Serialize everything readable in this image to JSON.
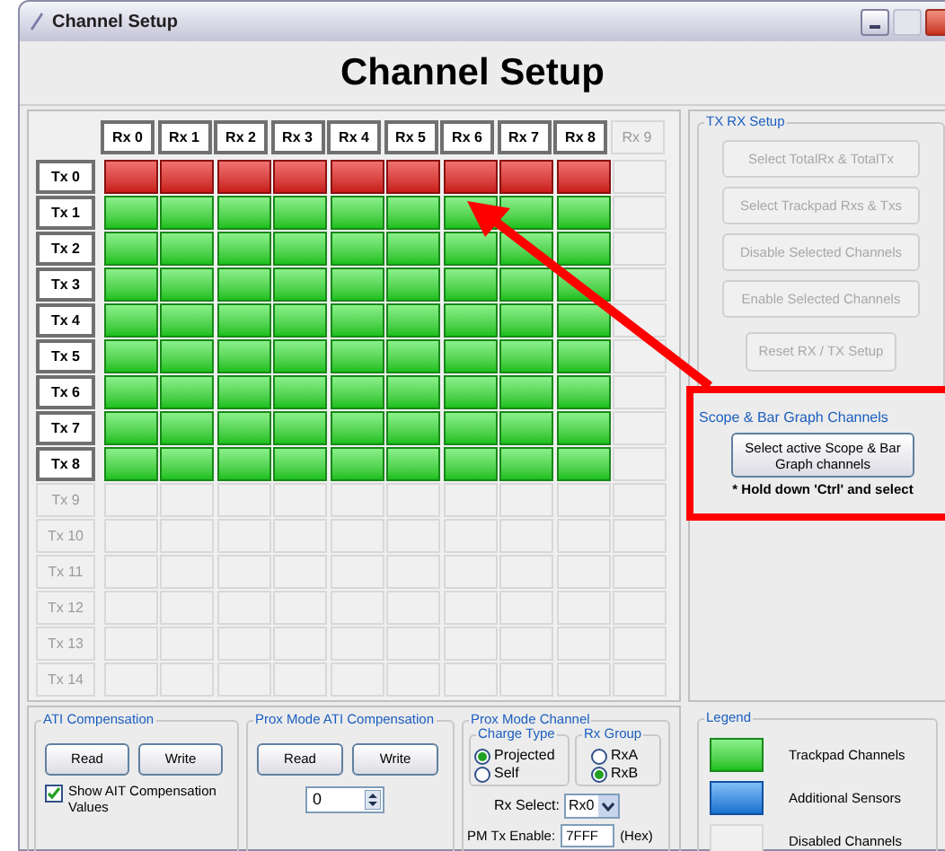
{
  "window": {
    "title": "Channel Setup"
  },
  "heading": "Channel Setup",
  "grid": {
    "columns": [
      {
        "label": "Rx 0",
        "enabled": true
      },
      {
        "label": "Rx 1",
        "enabled": true
      },
      {
        "label": "Rx 2",
        "enabled": true
      },
      {
        "label": "Rx 3",
        "enabled": true
      },
      {
        "label": "Rx 4",
        "enabled": true
      },
      {
        "label": "Rx 5",
        "enabled": true
      },
      {
        "label": "Rx 6",
        "enabled": true
      },
      {
        "label": "Rx 7",
        "enabled": true
      },
      {
        "label": "Rx 8",
        "enabled": true
      },
      {
        "label": "Rx 9",
        "enabled": false
      }
    ],
    "rows": [
      {
        "label": "Tx 0",
        "enabled": true,
        "cells": [
          {
            "kind": "selected"
          },
          {
            "kind": "selected"
          },
          {
            "kind": "selected"
          },
          {
            "kind": "selected"
          },
          {
            "kind": "selected"
          },
          {
            "kind": "selected"
          },
          {
            "kind": "selected"
          },
          {
            "kind": "selected"
          },
          {
            "kind": "selected"
          },
          {
            "kind": "disabled"
          }
        ]
      },
      {
        "label": "Tx 1",
        "enabled": true,
        "cells": [
          {
            "kind": "trackpad"
          },
          {
            "kind": "trackpad"
          },
          {
            "kind": "trackpad"
          },
          {
            "kind": "trackpad"
          },
          {
            "kind": "trackpad"
          },
          {
            "kind": "trackpad"
          },
          {
            "kind": "trackpad"
          },
          {
            "kind": "trackpad"
          },
          {
            "kind": "trackpad"
          },
          {
            "kind": "disabled"
          }
        ]
      },
      {
        "label": "Tx 2",
        "enabled": true,
        "cells": [
          {
            "kind": "trackpad"
          },
          {
            "kind": "trackpad"
          },
          {
            "kind": "trackpad"
          },
          {
            "kind": "trackpad"
          },
          {
            "kind": "trackpad"
          },
          {
            "kind": "trackpad"
          },
          {
            "kind": "trackpad"
          },
          {
            "kind": "trackpad"
          },
          {
            "kind": "trackpad"
          },
          {
            "kind": "disabled"
          }
        ]
      },
      {
        "label": "Tx 3",
        "enabled": true,
        "cells": [
          {
            "kind": "trackpad"
          },
          {
            "kind": "trackpad"
          },
          {
            "kind": "trackpad"
          },
          {
            "kind": "trackpad"
          },
          {
            "kind": "trackpad"
          },
          {
            "kind": "trackpad"
          },
          {
            "kind": "trackpad"
          },
          {
            "kind": "trackpad"
          },
          {
            "kind": "trackpad"
          },
          {
            "kind": "disabled"
          }
        ]
      },
      {
        "label": "Tx 4",
        "enabled": true,
        "cells": [
          {
            "kind": "trackpad"
          },
          {
            "kind": "trackpad"
          },
          {
            "kind": "trackpad"
          },
          {
            "kind": "trackpad"
          },
          {
            "kind": "trackpad"
          },
          {
            "kind": "trackpad"
          },
          {
            "kind": "trackpad"
          },
          {
            "kind": "trackpad"
          },
          {
            "kind": "trackpad"
          },
          {
            "kind": "disabled"
          }
        ]
      },
      {
        "label": "Tx 5",
        "enabled": true,
        "cells": [
          {
            "kind": "trackpad"
          },
          {
            "kind": "trackpad"
          },
          {
            "kind": "trackpad"
          },
          {
            "kind": "trackpad"
          },
          {
            "kind": "trackpad"
          },
          {
            "kind": "trackpad"
          },
          {
            "kind": "trackpad"
          },
          {
            "kind": "trackpad"
          },
          {
            "kind": "trackpad"
          },
          {
            "kind": "disabled"
          }
        ]
      },
      {
        "label": "Tx 6",
        "enabled": true,
        "cells": [
          {
            "kind": "trackpad"
          },
          {
            "kind": "trackpad"
          },
          {
            "kind": "trackpad"
          },
          {
            "kind": "trackpad"
          },
          {
            "kind": "trackpad"
          },
          {
            "kind": "trackpad"
          },
          {
            "kind": "trackpad"
          },
          {
            "kind": "trackpad"
          },
          {
            "kind": "trackpad"
          },
          {
            "kind": "disabled"
          }
        ]
      },
      {
        "label": "Tx 7",
        "enabled": true,
        "cells": [
          {
            "kind": "trackpad"
          },
          {
            "kind": "trackpad"
          },
          {
            "kind": "trackpad"
          },
          {
            "kind": "trackpad"
          },
          {
            "kind": "trackpad"
          },
          {
            "kind": "trackpad"
          },
          {
            "kind": "trackpad"
          },
          {
            "kind": "trackpad"
          },
          {
            "kind": "trackpad"
          },
          {
            "kind": "disabled"
          }
        ]
      },
      {
        "label": "Tx 8",
        "enabled": true,
        "cells": [
          {
            "kind": "trackpad"
          },
          {
            "kind": "trackpad"
          },
          {
            "kind": "trackpad"
          },
          {
            "kind": "trackpad"
          },
          {
            "kind": "trackpad"
          },
          {
            "kind": "trackpad"
          },
          {
            "kind": "trackpad"
          },
          {
            "kind": "trackpad"
          },
          {
            "kind": "trackpad"
          },
          {
            "kind": "disabled"
          }
        ]
      },
      {
        "label": "Tx 9",
        "enabled": false,
        "cells": [
          {
            "kind": "disabled"
          },
          {
            "kind": "disabled"
          },
          {
            "kind": "disabled"
          },
          {
            "kind": "disabled"
          },
          {
            "kind": "disabled"
          },
          {
            "kind": "disabled"
          },
          {
            "kind": "disabled"
          },
          {
            "kind": "disabled"
          },
          {
            "kind": "disabled"
          },
          {
            "kind": "disabled"
          }
        ]
      },
      {
        "label": "Tx 10",
        "enabled": false,
        "cells": [
          {
            "kind": "disabled"
          },
          {
            "kind": "disabled"
          },
          {
            "kind": "disabled"
          },
          {
            "kind": "disabled"
          },
          {
            "kind": "disabled"
          },
          {
            "kind": "disabled"
          },
          {
            "kind": "disabled"
          },
          {
            "kind": "disabled"
          },
          {
            "kind": "disabled"
          },
          {
            "kind": "disabled"
          }
        ]
      },
      {
        "label": "Tx 11",
        "enabled": false,
        "cells": [
          {
            "kind": "disabled"
          },
          {
            "kind": "disabled"
          },
          {
            "kind": "disabled"
          },
          {
            "kind": "disabled"
          },
          {
            "kind": "disabled"
          },
          {
            "kind": "disabled"
          },
          {
            "kind": "disabled"
          },
          {
            "kind": "disabled"
          },
          {
            "kind": "disabled"
          },
          {
            "kind": "disabled"
          }
        ]
      },
      {
        "label": "Tx 12",
        "enabled": false,
        "cells": [
          {
            "kind": "disabled"
          },
          {
            "kind": "disabled"
          },
          {
            "kind": "disabled"
          },
          {
            "kind": "disabled"
          },
          {
            "kind": "disabled"
          },
          {
            "kind": "disabled"
          },
          {
            "kind": "disabled"
          },
          {
            "kind": "disabled"
          },
          {
            "kind": "disabled"
          },
          {
            "kind": "disabled"
          }
        ]
      },
      {
        "label": "Tx 13",
        "enabled": false,
        "cells": [
          {
            "kind": "disabled"
          },
          {
            "kind": "disabled"
          },
          {
            "kind": "disabled"
          },
          {
            "kind": "disabled"
          },
          {
            "kind": "disabled"
          },
          {
            "kind": "disabled"
          },
          {
            "kind": "disabled"
          },
          {
            "kind": "disabled"
          },
          {
            "kind": "disabled"
          },
          {
            "kind": "disabled"
          }
        ]
      },
      {
        "label": "Tx 14",
        "enabled": false,
        "cells": [
          {
            "kind": "disabled"
          },
          {
            "kind": "disabled"
          },
          {
            "kind": "disabled"
          },
          {
            "kind": "disabled"
          },
          {
            "kind": "disabled"
          },
          {
            "kind": "disabled"
          },
          {
            "kind": "disabled"
          },
          {
            "kind": "disabled"
          },
          {
            "kind": "disabled"
          },
          {
            "kind": "disabled"
          }
        ]
      }
    ]
  },
  "tx_rx_setup": {
    "title": "TX RX Setup",
    "buttons": [
      {
        "label": "Select TotalRx & TotalTx",
        "disabled": true
      },
      {
        "label": "Select Trackpad Rxs & Txs",
        "disabled": true
      },
      {
        "label": "Disable Selected Channels",
        "disabled": true
      },
      {
        "label": "Enable Selected Channels",
        "disabled": true
      },
      {
        "label": "Reset RX / TX Setup",
        "disabled": true
      }
    ]
  },
  "scope_channels": {
    "title": "Scope & Bar Graph Channels",
    "button": "Select active Scope & Bar Graph channels",
    "note": "* Hold down 'Ctrl' and select"
  },
  "ati_compensation": {
    "title": "ATI Compensation",
    "buttons": [
      "Read",
      "Write"
    ],
    "checkbox": {
      "label": "Show AIT Compensation Values",
      "checked": true
    }
  },
  "prox_ati_compensation": {
    "title": "Prox Mode ATI Compensation",
    "buttons": [
      "Read",
      "Write"
    ],
    "value": "0"
  },
  "prox_mode_channel": {
    "title": "Prox Mode Channel",
    "charge_type": {
      "title": "Charge Type",
      "options": [
        {
          "label": "Projected",
          "selected": true
        },
        {
          "label": "Self",
          "selected": false
        }
      ]
    },
    "rx_group": {
      "title": "Rx Group",
      "options": [
        {
          "label": "RxA",
          "selected": false
        },
        {
          "label": "RxB",
          "selected": true
        }
      ]
    },
    "rx_select": {
      "label": "Rx Select:",
      "value": "Rx0"
    },
    "pm_tx_enable": {
      "label": "PM Tx Enable:",
      "value": "7FFF",
      "unit": "(Hex)"
    }
  },
  "legend": {
    "title": "Legend",
    "items": [
      {
        "label": "Trackpad Channels",
        "kind": "trackpad"
      },
      {
        "label": "Additional Sensors",
        "kind": "additional"
      },
      {
        "label": "Disabled Channels",
        "kind": "disabled"
      }
    ]
  }
}
